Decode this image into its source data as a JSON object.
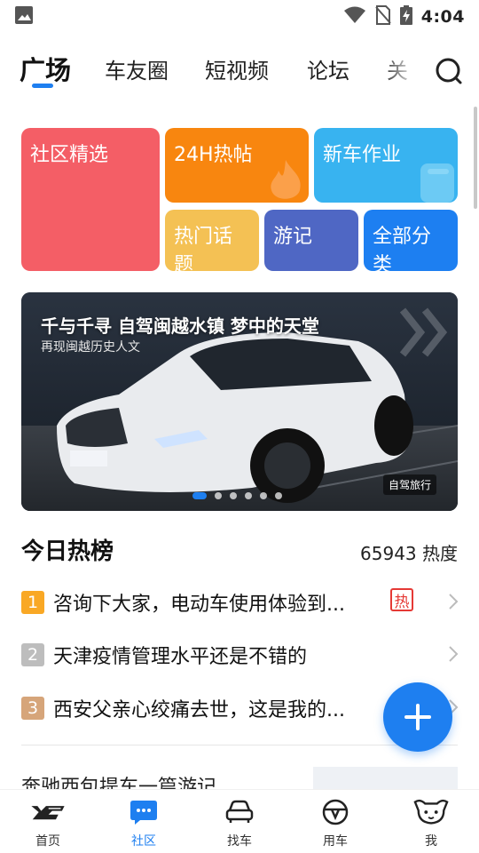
{
  "status_bar": {
    "time": "4:04",
    "icons": [
      "image-icon",
      "wifi-icon",
      "no-sim-icon",
      "battery-charging-icon"
    ]
  },
  "tabs": [
    {
      "label": "广场",
      "active": true
    },
    {
      "label": "车友圈",
      "active": false
    },
    {
      "label": "短视频",
      "active": false
    },
    {
      "label": "论坛",
      "active": false
    },
    {
      "label": "关",
      "active": false
    }
  ],
  "search_icon": "search-icon",
  "categories": {
    "community": "社区精选",
    "hot24": "24H热帖",
    "newcar": "新车作业",
    "topics": "热门话题",
    "travel": "游记",
    "all": "全部分类"
  },
  "category_colors": {
    "community": "#f45e66",
    "hot24": "#f8860f",
    "newcar": "#38b3f0",
    "topics": "#f4c154",
    "travel": "#4f67c4",
    "all": "#1d7ff1"
  },
  "banner": {
    "title": "千与千寻 自驾闽越水镇 梦中的天堂",
    "subtitle": "再现闽越历史人文",
    "tag": "自驾旅行",
    "dots_total": 6,
    "dots_active": 1
  },
  "hot_list": {
    "title": "今日热榜",
    "count": "65943 热度",
    "items": [
      {
        "rank": "1",
        "text": "咨询下大家，电动车使用体验到...",
        "badge": "热"
      },
      {
        "rank": "2",
        "text": "天津疫情管理水平还是不错的",
        "badge": ""
      },
      {
        "rank": "3",
        "text": "西安父亲心绞痛去世，这是我的...",
        "badge": ""
      }
    ]
  },
  "next_item_text": "奔驰西包提车一篇游记",
  "fab_icon": "plus-icon",
  "bottom_nav": [
    {
      "label": "首页",
      "icon": "xcar-logo-icon",
      "active": false
    },
    {
      "label": "社区",
      "icon": "chat-bubble-icon",
      "active": true
    },
    {
      "label": "找车",
      "icon": "car-icon",
      "active": false
    },
    {
      "label": "用车",
      "icon": "steering-wheel-icon",
      "active": false
    },
    {
      "label": "我",
      "icon": "profile-mascot-icon",
      "active": false
    }
  ],
  "accent_color": "#1e7ff0"
}
